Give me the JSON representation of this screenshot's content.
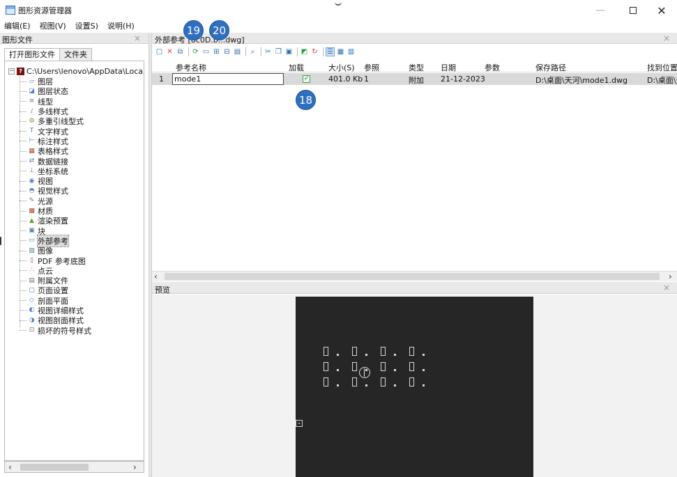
{
  "window": {
    "title": "图形资源管理器",
    "minimize_glyph": "—",
    "close_glyph": "✕"
  },
  "menu": [
    "编辑(E)",
    "视图(V)",
    "设置S)",
    "说明(H)"
  ],
  "left_panel": {
    "title": "图形文件",
    "close_glyph": "×",
    "tabs": [
      "打开图形文件",
      "文件夹"
    ],
    "root_path": "C:\\Users\\lenovo\\AppData\\Local\\T",
    "items": [
      {
        "label": "图层",
        "icon": "layer-icon"
      },
      {
        "label": "图层状态",
        "icon": "layer-state-icon"
      },
      {
        "label": "线型",
        "icon": "linetype-icon"
      },
      {
        "label": "多线样式",
        "icon": "multiline-style-icon"
      },
      {
        "label": "多重引线型式",
        "icon": "multileader-style-icon"
      },
      {
        "label": "文字样式",
        "icon": "text-style-icon"
      },
      {
        "label": "标注样式",
        "icon": "dimension-style-icon"
      },
      {
        "label": "表格样式",
        "icon": "table-style-icon"
      },
      {
        "label": "数据链接",
        "icon": "data-link-icon"
      },
      {
        "label": "坐标系统",
        "icon": "ucs-icon"
      },
      {
        "label": "视图",
        "icon": "view-icon"
      },
      {
        "label": "视觉样式",
        "icon": "visual-style-icon"
      },
      {
        "label": "光源",
        "icon": "light-icon"
      },
      {
        "label": "材质",
        "icon": "material-icon"
      },
      {
        "label": "渲染预置",
        "icon": "render-preset-icon"
      },
      {
        "label": "块",
        "icon": "block-icon"
      },
      {
        "label": "外部参考",
        "icon": "xref-icon",
        "selected": true
      },
      {
        "label": "图像",
        "icon": "image-icon"
      },
      {
        "label": "PDF 参考底图",
        "icon": "pdf-icon"
      },
      {
        "label": "点云",
        "icon": "point-cloud-icon"
      },
      {
        "label": "附属文件",
        "icon": "attached-file-icon"
      },
      {
        "label": "页面设置",
        "icon": "page-setup-icon"
      },
      {
        "label": "剖面平面",
        "icon": "section-plane-icon"
      },
      {
        "label": "视图详细样式",
        "icon": "detail-view-style-icon"
      },
      {
        "label": "视图剖面样式",
        "icon": "section-view-style-icon"
      },
      {
        "label": "损坏的符号样式",
        "icon": "broken-symbol-style-icon"
      }
    ]
  },
  "xref_panel": {
    "title": "外部参考 [8c0D.b...dwg]",
    "close_glyph": "×",
    "columns": [
      "参考名称",
      "加载",
      "大小(S)",
      "参照",
      "类型",
      "日期",
      "参数",
      "保存路径",
      "找到位置"
    ],
    "rows": [
      {
        "index": "1",
        "name": "mode1",
        "loaded_mark": "✓",
        "size": "401.0 Kb",
        "refs": "1",
        "type": "附加",
        "date": "21-12-2023",
        "params": "",
        "saved_path": "D:\\桌面\\天河\\mode1.dwg",
        "found_at": "D:\\桌面\\天"
      }
    ]
  },
  "preview_panel": {
    "title": "预览",
    "close_glyph": "×"
  },
  "badges": [
    "19",
    "20",
    "18"
  ],
  "colors": {
    "badge": "#2f6fbf",
    "preview_bg": "#262626",
    "selected_row": "#d9d9d9"
  }
}
